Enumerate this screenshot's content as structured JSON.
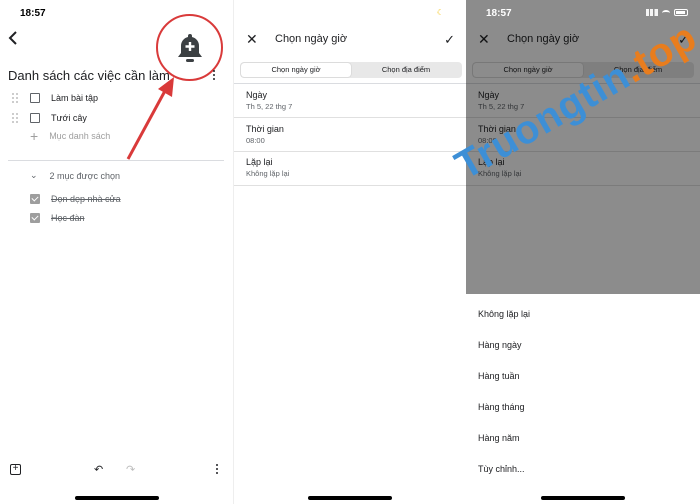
{
  "panel1": {
    "status_time": "18:57",
    "list_title": "Danh sách các việc cần làm",
    "tasks": [
      {
        "label": "Làm bài tập"
      },
      {
        "label": "Tưới cây"
      }
    ],
    "add_item_placeholder": "Mục danh sách",
    "checked_header": "2 mục được chọn",
    "checked_items": [
      {
        "label": "Dọn dẹp nhà cửa"
      },
      {
        "label": "Học đàn"
      }
    ],
    "icons": {
      "back": "back-arrow-icon",
      "alarm": "add-alarm-icon",
      "more": "more-vert-icon"
    },
    "accent_color": "#d93a3a"
  },
  "panel2": {
    "title": "Chọn ngày giờ",
    "segments": [
      "Chọn ngày giờ",
      "Chọn địa điểm"
    ],
    "fields": [
      {
        "label": "Ngày",
        "value": "Th 5, 22 thg 7"
      },
      {
        "label": "Thời gian",
        "value": "08:00"
      },
      {
        "label": "Lặp lại",
        "value": "Không lặp lại"
      }
    ]
  },
  "panel3": {
    "status_time": "18:57",
    "title": "Chọn ngày giờ",
    "segments": [
      "Chọn ngày giờ",
      "Chọn địa điểm"
    ],
    "fields": [
      {
        "label": "Ngày",
        "value": "Th 5, 22 thg 7"
      },
      {
        "label": "Thời gian",
        "value": "08:00"
      },
      {
        "label": "Lặp lại",
        "value": "Không lặp lại"
      }
    ],
    "repeat_options": [
      "Không lặp lại",
      "Hàng ngày",
      "Hàng tuần",
      "Hàng tháng",
      "Hàng năm",
      "Tùy chỉnh..."
    ]
  },
  "watermark": {
    "part1": "Truongtin",
    "part2": ".top"
  }
}
